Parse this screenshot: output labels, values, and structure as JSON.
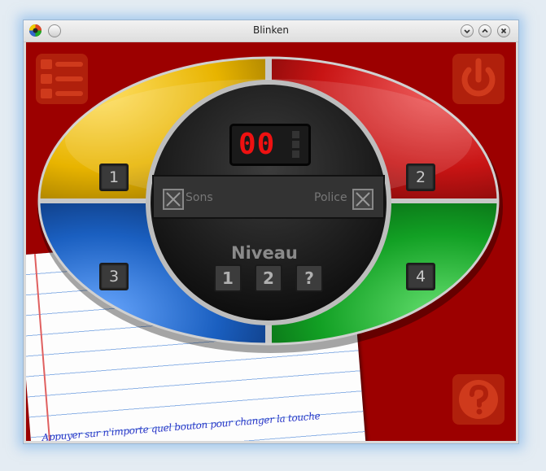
{
  "window": {
    "title": "Blinken"
  },
  "titlebar": {
    "menu_icon": "app-menu-icon",
    "buttons": [
      "minimize-icon",
      "maximize-icon",
      "close-icon"
    ]
  },
  "colors": {
    "yellow": "#e8b400",
    "red": "#c81414",
    "blue": "#1a5fc0",
    "green": "#12a024",
    "background": "#9c0000",
    "counter": "#e11111"
  },
  "board": {
    "counter": "00",
    "buttons": {
      "yellow": "1",
      "red": "2",
      "blue": "3",
      "green": "4"
    },
    "options": {
      "sound_label": "Sons",
      "font_label": "Police"
    },
    "level": {
      "title": "Niveau",
      "options": [
        "1",
        "2",
        "?"
      ]
    }
  },
  "corners": {
    "top_left": "high-scores-icon",
    "top_right": "power-icon",
    "bottom_right": "help-icon"
  },
  "hint": "Appuyer sur n'importe quel bouton pour changer la touche"
}
